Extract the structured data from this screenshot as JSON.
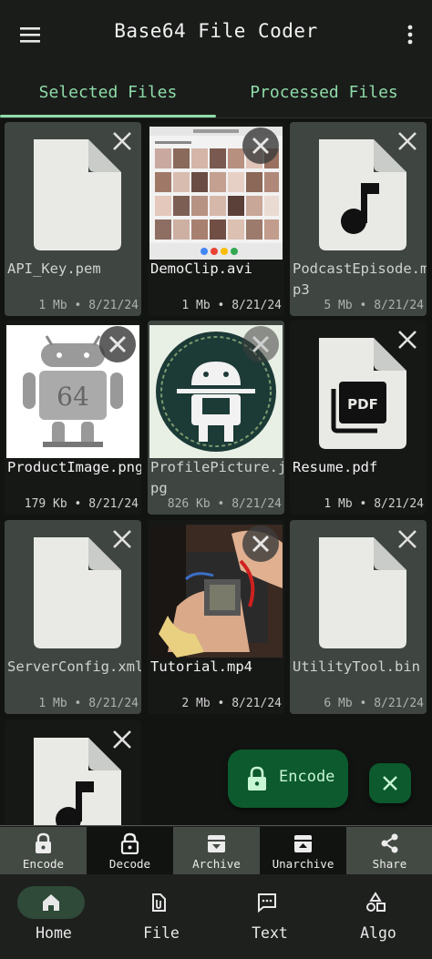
{
  "app": {
    "title": "Base64 File Coder"
  },
  "tabs": [
    {
      "label": "Selected Files"
    },
    {
      "label": "Processed Files"
    }
  ],
  "files": [
    {
      "name": "API_Key.pem",
      "size": "1 Mb",
      "date": "8/21/24",
      "icon": "file-icon"
    },
    {
      "name": "DemoClip.avi",
      "size": "1 Mb",
      "date": "8/21/24",
      "icon": "video-thumbnail"
    },
    {
      "name": "PodcastEpisode.mp3",
      "size": "5 Mb",
      "date": "8/21/24",
      "icon": "music-file-icon"
    },
    {
      "name": "ProductImage.png",
      "size": "179 Kb",
      "date": "8/21/24",
      "icon": "image-thumbnail"
    },
    {
      "name": "ProfilePicture.jpg",
      "size": "826 Kb",
      "date": "8/21/24",
      "icon": "image-thumbnail"
    },
    {
      "name": "Resume.pdf",
      "size": "1 Mb",
      "date": "8/21/24",
      "icon": "pdf-file-icon"
    },
    {
      "name": "ServerConfig.xml",
      "size": "1 Mb",
      "date": "8/21/24",
      "icon": "file-icon"
    },
    {
      "name": "Tutorial.mp4",
      "size": "2 Mb",
      "date": "8/21/24",
      "icon": "video-thumbnail"
    },
    {
      "name": "UtilityTool.bin",
      "size": "6 Mb",
      "date": "8/21/24",
      "icon": "file-icon"
    },
    {
      "name": "",
      "size": "",
      "date": "",
      "icon": "music-file-icon"
    }
  ],
  "fab": {
    "encode_label": "Encode"
  },
  "actions": [
    {
      "label": "Encode",
      "icon": "lock-icon"
    },
    {
      "label": "Decode",
      "icon": "unlock-icon"
    },
    {
      "label": "Archive",
      "icon": "archive-icon"
    },
    {
      "label": "Unarchive",
      "icon": "unarchive-icon"
    },
    {
      "label": "Share",
      "icon": "share-icon"
    }
  ],
  "nav": [
    {
      "label": "Home",
      "icon": "home-icon",
      "selected": true
    },
    {
      "label": "File",
      "icon": "file-attach-icon"
    },
    {
      "label": "Text",
      "icon": "text-bubble-icon"
    },
    {
      "label": "Algo",
      "icon": "shapes-icon"
    }
  ],
  "colors": {
    "accent": "#8fdca9",
    "fab": "#0c5a2e",
    "background": "#121412"
  }
}
